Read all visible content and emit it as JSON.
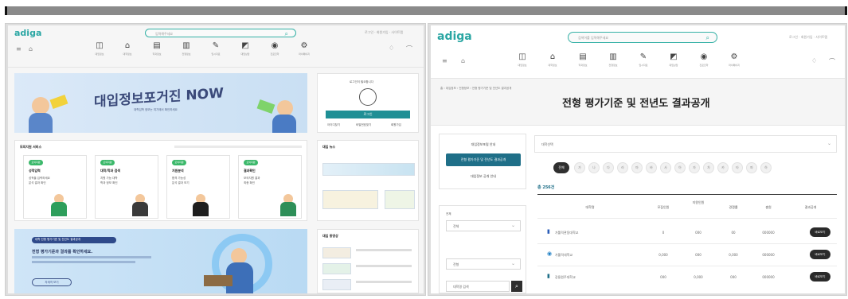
{
  "left": {
    "logo": "adiga",
    "search_placeholder": "입력해주세요",
    "toplinks": "로그인 · 회원가입 · 사이트맵",
    "nav": [
      "대입정보",
      "대학정보",
      "학과정보",
      "전형정보",
      "입시자료",
      "대입상담",
      "진로진학",
      "마이페이지"
    ],
    "banner_title": "대입정보포거진 NOW",
    "banner_sub": "대학입학 정보는 여기에서 확인하세요",
    "login_prompt": "로그인이 필요합니다",
    "login_button": "로그인",
    "login_links": [
      "아이디찾기",
      "비밀번호찾기",
      "회원가입"
    ],
    "section_title": "모의지원 서비스",
    "cards": [
      {
        "badge": "모의지원",
        "title": "성적입력",
        "line1": "성적을 입력하세요",
        "line2": "분석 결과 확인"
      },
      {
        "badge": "모의지원",
        "title": "대학/학과 검색",
        "line1": "지원 가능 대학",
        "line2": "학과 정보 확인"
      },
      {
        "badge": "모의지원",
        "title": "지원분석",
        "line1": "합격 가능성",
        "line2": "분석 결과 보기"
      },
      {
        "badge": "모의지원",
        "title": "결과확인",
        "line1": "모의지원 결과",
        "line2": "최종 확인"
      }
    ],
    "news_title": "대입 뉴스",
    "bottom_banner_tag": "대학 전형 평가기준 및 전년도 결과공개",
    "bottom_banner_title": "전형 평가기준과 결과를 확인하세요.",
    "bottom_banner_link": "자세히 보기",
    "video_title": "대입 동영상"
  },
  "right": {
    "logo": "adiga",
    "search_placeholder": "검색어를 입력해주세요",
    "toplinks": "로그인 · 회원가입 · 사이트맵",
    "nav": [
      "대입정보",
      "대학정보",
      "학과정보",
      "전형정보",
      "입시자료",
      "대입상담",
      "진로진학",
      "마이페이지"
    ],
    "breadcrumb": "홈 › 대입정보 › 전형정보 › 전형 평가기준 및 전년도 결과공개",
    "page_title": "전형 평가기준 및 전년도 결과공개",
    "side_items": [
      "대입정보포털 안내",
      "전형 평가기준 및 전년도 결과공개",
      "대입정보 공개 안내"
    ],
    "filter1": "전체",
    "filter2": "전형",
    "search_input_placeholder": "대학명 검색",
    "top_select": "대학선택",
    "chips": [
      "전체",
      "가",
      "나",
      "다",
      "라",
      "마",
      "바",
      "사",
      "아",
      "자",
      "차",
      "카",
      "타",
      "파",
      "하"
    ],
    "total": "총 256건",
    "headers": [
      "대학명",
      "모집인원",
      "지원인원",
      "경쟁률",
      "충원",
      "결과공개",
      "바로보기"
    ],
    "rows": [
      {
        "name": "가톨릭관동대학교",
        "v1": "0",
        "v2": "000",
        "v3": "00",
        "v4": "000000",
        "btn": "바로보기"
      },
      {
        "name": "가톨릭대학교",
        "v1": "0,000",
        "v2": "000",
        "v3": "0,000",
        "v4": "000000",
        "btn": "바로보기"
      },
      {
        "name": "강릉원주대학교",
        "v1": "000",
        "v2": "0,000",
        "v3": "000",
        "v4": "000000",
        "btn": "바로보기"
      }
    ]
  }
}
